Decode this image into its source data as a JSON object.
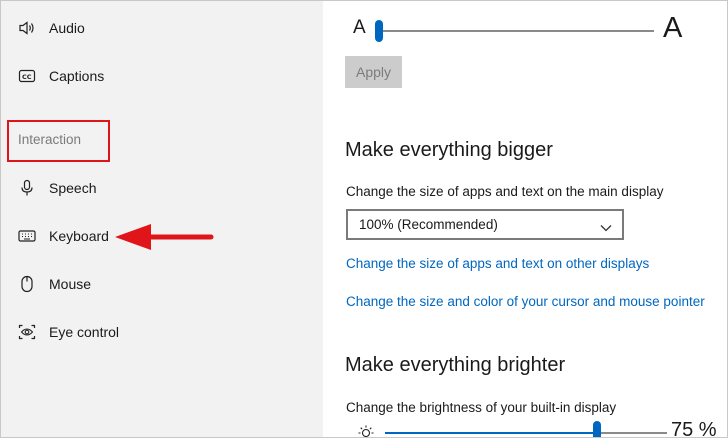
{
  "sidebar": {
    "items": [
      {
        "label": "Audio",
        "icon": "speaker-icon"
      },
      {
        "label": "Captions",
        "icon": "captions-icon"
      },
      {
        "label": "Speech",
        "icon": "microphone-icon"
      },
      {
        "label": "Keyboard",
        "icon": "keyboard-icon"
      },
      {
        "label": "Mouse",
        "icon": "mouse-icon"
      },
      {
        "label": "Eye control",
        "icon": "eye-control-icon"
      }
    ],
    "section_label": "Interaction"
  },
  "annotation": {
    "color": "#e0151a"
  },
  "text_size": {
    "small_a": "A",
    "large_a": "A",
    "apply_label": "Apply",
    "slider_value": 0.0
  },
  "bigger": {
    "heading": "Make everything bigger",
    "description": "Change the size of apps and text on the main display",
    "selected_option": "100% (Recommended)",
    "link_other_displays": "Change the size of apps and text on other displays",
    "link_cursor": "Change the size and color of your cursor and mouse pointer"
  },
  "brighter": {
    "heading": "Make everything brighter",
    "description": "Change the brightness of your built-in display",
    "brightness_text": "75 %",
    "brightness_value": 75
  },
  "colors": {
    "accent": "#0067c0",
    "sidebar_bg": "#f2f2f2"
  }
}
